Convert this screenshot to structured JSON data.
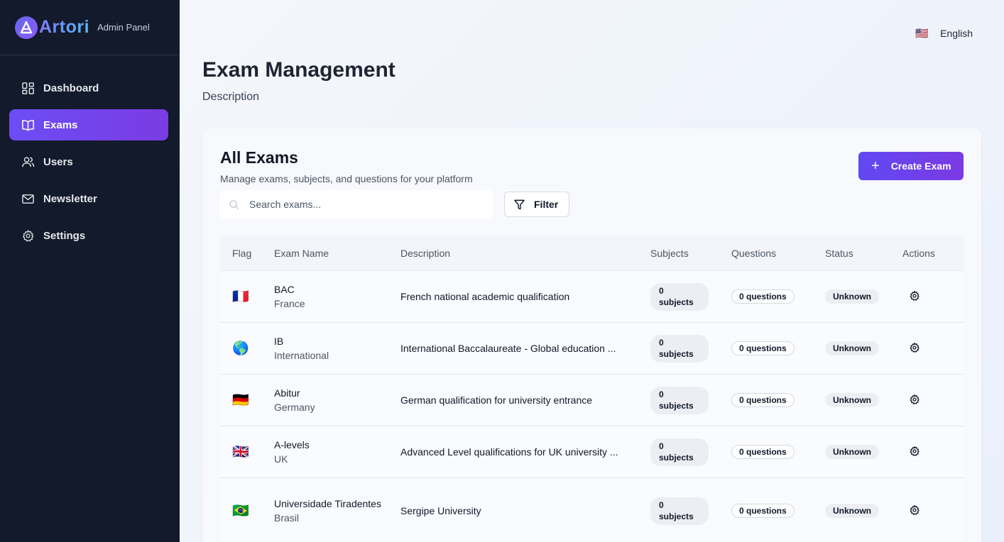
{
  "brand": {
    "name": "Artori",
    "subtitle": "Admin Panel"
  },
  "sidebar": {
    "items": [
      {
        "label": "Dashboard",
        "icon": "dashboard-icon",
        "active": false
      },
      {
        "label": "Exams",
        "icon": "book-icon",
        "active": true
      },
      {
        "label": "Users",
        "icon": "users-icon",
        "active": false
      },
      {
        "label": "Newsletter",
        "icon": "mail-icon",
        "active": false
      },
      {
        "label": "Settings",
        "icon": "gear-icon",
        "active": false
      }
    ]
  },
  "header": {
    "language": "English",
    "language_flag": "🇺🇸"
  },
  "page": {
    "title": "Exam Management",
    "description": "Description"
  },
  "card": {
    "title": "All Exams",
    "subtitle": "Manage exams, subjects, and questions for your platform",
    "create_label": "Create Exam",
    "search_placeholder": "Search exams...",
    "filter_label": "Filter"
  },
  "table": {
    "columns": [
      "Flag",
      "Exam Name",
      "Description",
      "Subjects",
      "Questions",
      "Status",
      "Actions"
    ],
    "rows": [
      {
        "flag": "🇫🇷",
        "name": "BAC",
        "country": "France",
        "description": "French national academic qualification",
        "subjects": "0 subjects",
        "questions": "0 questions",
        "status": "Unknown"
      },
      {
        "flag": "🌎",
        "name": "IB",
        "country": "International",
        "description": "International Baccalaureate - Global education ...",
        "subjects": "0 subjects",
        "questions": "0 questions",
        "status": "Unknown"
      },
      {
        "flag": "🇩🇪",
        "name": "Abitur",
        "country": "Germany",
        "description": "German qualification for university entrance",
        "subjects": "0 subjects",
        "questions": "0 questions",
        "status": "Unknown"
      },
      {
        "flag": "🇬🇧",
        "name": "A-levels",
        "country": "UK",
        "description": "Advanced Level qualifications for UK university ...",
        "subjects": "0 subjects",
        "questions": "0 questions",
        "status": "Unknown"
      },
      {
        "flag": "🇧🇷",
        "name": "Universidade Tiradentes",
        "country": "Brasil",
        "description": "Sergipe University",
        "subjects": "0 subjects",
        "questions": "0 questions",
        "status": "Unknown"
      }
    ]
  },
  "colors": {
    "sidebar_bg": "#131a2b",
    "accent": "#6c4df5",
    "accent_end": "#7b3be2"
  }
}
